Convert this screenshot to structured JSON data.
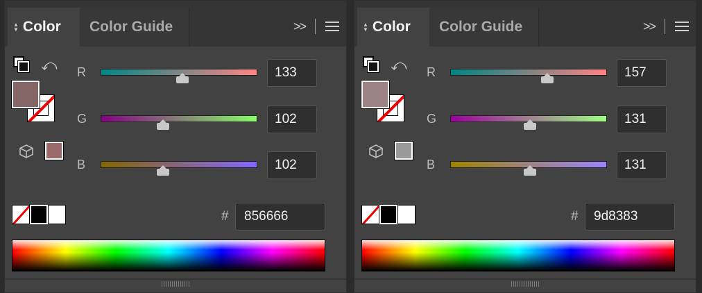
{
  "panels": [
    {
      "tabs": {
        "active": "Color",
        "inactive": "Color Guide"
      },
      "fill_color": "#856666",
      "out_of_gamut_color": "#9b6b6b",
      "channels": [
        {
          "label": "R",
          "value": "133",
          "fraction": 0.52,
          "grad": "linear-gradient(to right,#008585,#ff8585)"
        },
        {
          "label": "G",
          "value": "102",
          "fraction": 0.4,
          "grad": "linear-gradient(to right,#850085,#85ff66)"
        },
        {
          "label": "B",
          "value": "102",
          "fraction": 0.4,
          "grad": "linear-gradient(to right,#856600,#8566ff)"
        }
      ],
      "hex": "856666",
      "hash": "#"
    },
    {
      "tabs": {
        "active": "Color",
        "inactive": "Color Guide"
      },
      "fill_color": "#9d8383",
      "out_of_gamut_color": "#9a9a9a",
      "channels": [
        {
          "label": "R",
          "value": "157",
          "fraction": 0.62,
          "grad": "linear-gradient(to right,#008383,#ff8383)"
        },
        {
          "label": "G",
          "value": "131",
          "fraction": 0.51,
          "grad": "linear-gradient(to right,#9d009d,#9dff83)"
        },
        {
          "label": "B",
          "value": "131",
          "fraction": 0.51,
          "grad": "linear-gradient(to right,#9d8300,#9d83ff)"
        }
      ],
      "hex": "9d8383",
      "hash": "#"
    }
  ]
}
